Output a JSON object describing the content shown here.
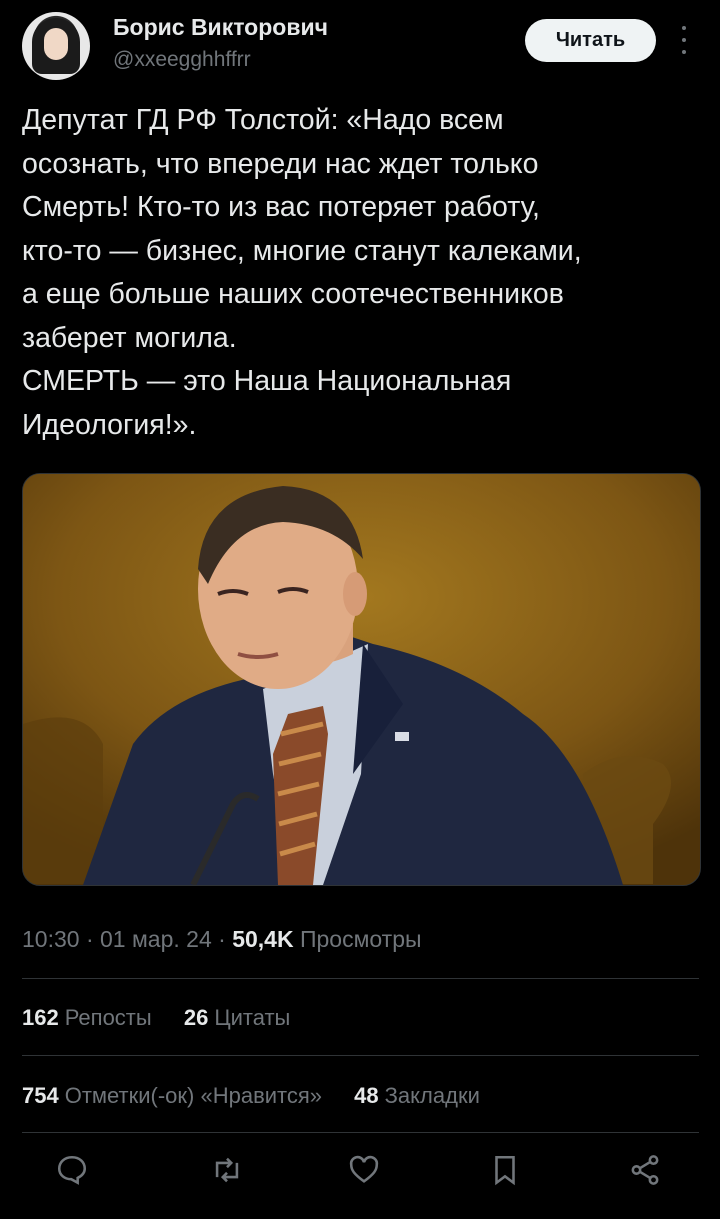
{
  "author": {
    "name": "Борис Викторович",
    "handle": "@xxeegghhffrr"
  },
  "follow_button": {
    "label": "Читать"
  },
  "tweet": {
    "text": "Депутат ГД РФ Толстой: «Надо всем\nосознать, что впереди нас ждет только\nСмерть! Кто-то из вас потеряет работу,\nкто-то — бизнес, многие станут калеками,\nа еще больше наших соотечественников\nзаберет могила.\nСМЕРТЬ  — это Наша Национальная\nИдеология!»."
  },
  "meta": {
    "time": "10:30",
    "date": "01 мар. 24",
    "views_count": "50,4K",
    "views_label": "Просмотры"
  },
  "stats": {
    "reposts_count": "162",
    "reposts_label": "Репосты",
    "quotes_count": "26",
    "quotes_label": "Цитаты",
    "likes_count": "754",
    "likes_label": "Отметки(-ок) «Нравится»",
    "bookmarks_count": "48",
    "bookmarks_label": "Закладки"
  },
  "actions": [
    "reply-icon",
    "retweet-icon",
    "like-icon",
    "bookmark-icon",
    "share-icon"
  ],
  "colors": {
    "background": "#000000",
    "text_primary": "#e7e9ea",
    "text_secondary": "#71767b",
    "divider": "#2f3336",
    "button_bg": "#eff3f4"
  }
}
